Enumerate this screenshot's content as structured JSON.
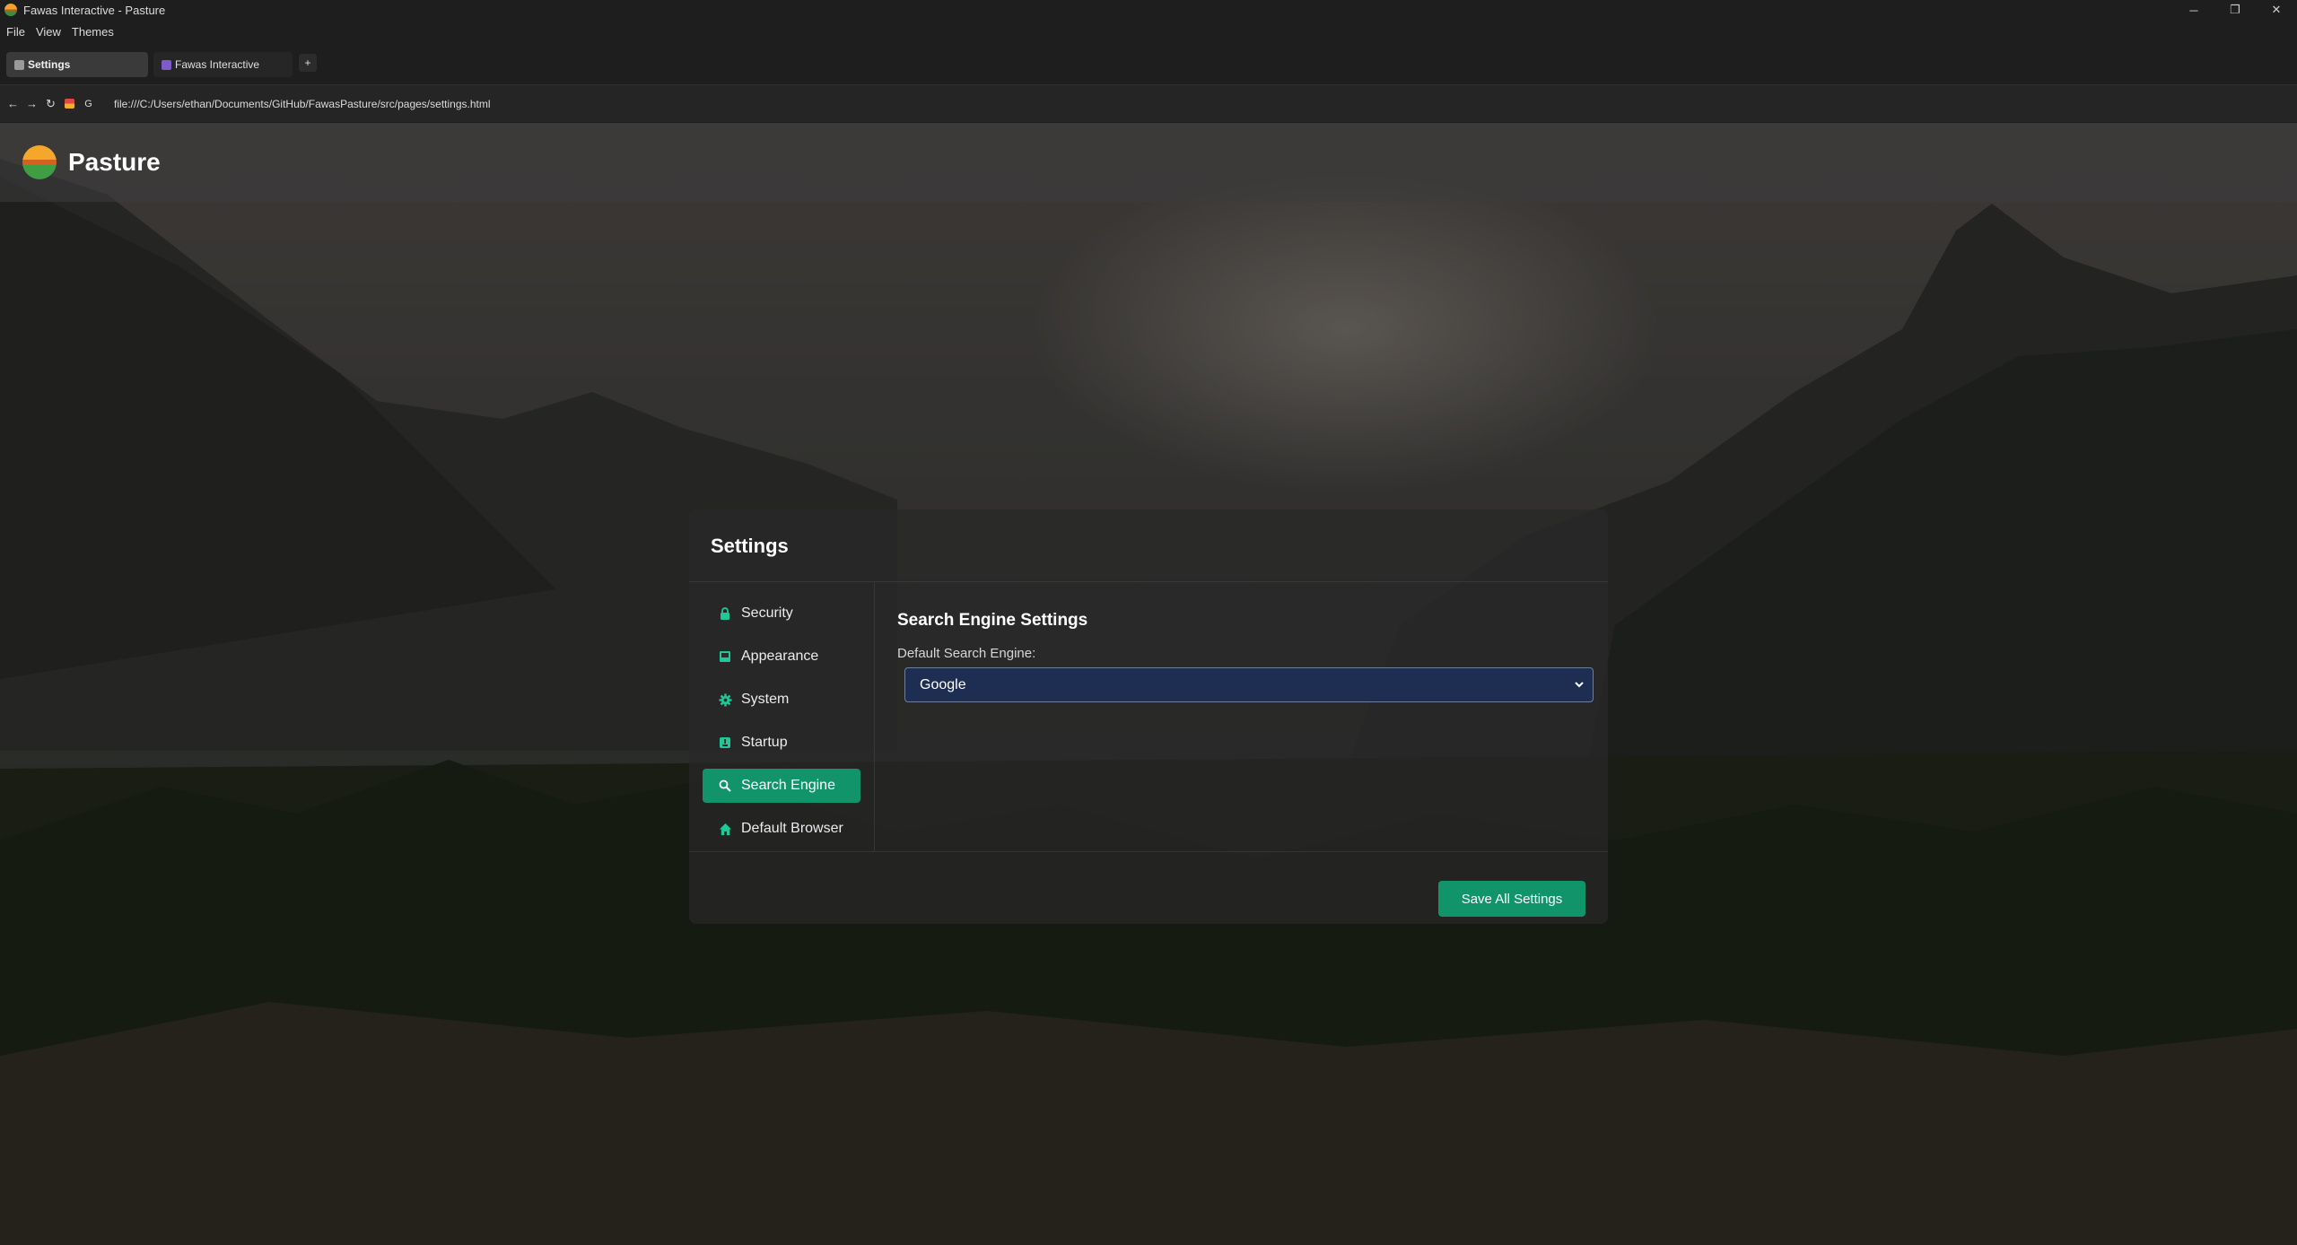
{
  "window": {
    "title": "Fawas Interactive - Pasture",
    "controls": {
      "minimize": "─",
      "restore": "❐",
      "close": "✕"
    }
  },
  "menu": {
    "items": [
      "File",
      "View",
      "Themes"
    ]
  },
  "tabs": [
    {
      "label": "Settings",
      "active": true
    },
    {
      "label": "Fawas Interactive",
      "active": false
    }
  ],
  "new_tab": {
    "label": "+"
  },
  "nav": {
    "back": "←",
    "forward": "→",
    "reload": "↻",
    "search_glyph": "G",
    "url": "file:///C:/Users/ethan/Documents/GitHub/FawasPasture/src/pages/settings.html"
  },
  "header": {
    "brand": "Pasture"
  },
  "settings": {
    "title": "Settings",
    "sidebar": [
      {
        "label": "Security",
        "icon": "lock-icon"
      },
      {
        "label": "Appearance",
        "icon": "picture-icon"
      },
      {
        "label": "System",
        "icon": "gear-icon"
      },
      {
        "label": "Startup",
        "icon": "power-icon"
      },
      {
        "label": "Search Engine",
        "icon": "search-icon",
        "active": true
      },
      {
        "label": "Default Browser",
        "icon": "home-icon"
      }
    ],
    "pane": {
      "title": "Search Engine Settings",
      "field_label": "Default Search Engine:",
      "selected": "Google"
    },
    "save_label": "Save All Settings"
  },
  "colors": {
    "accent": "#12946a",
    "select_bg": "#1d2e52"
  }
}
